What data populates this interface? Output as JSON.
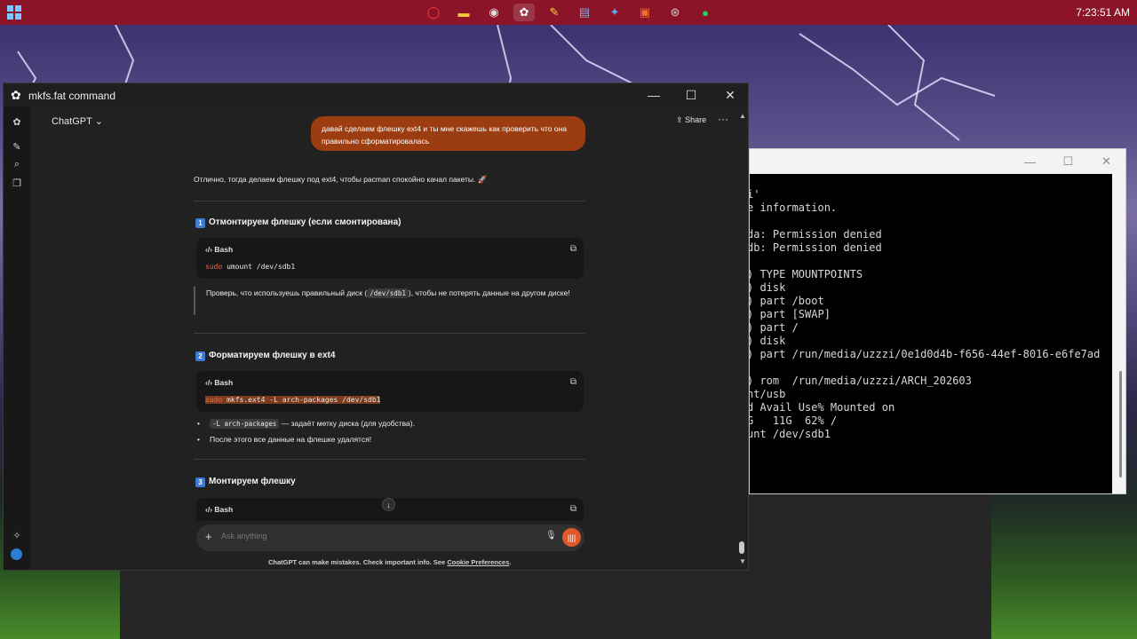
{
  "taskbar": {
    "clock": "7:23:51 AM",
    "icons": [
      "opera-icon",
      "file-explorer-icon",
      "obs-icon",
      "chatgpt-icon",
      "app-icon",
      "notes-icon",
      "vscode-icon",
      "office-icon",
      "steam-icon",
      "spotify-icon"
    ]
  },
  "terminal": {
    "lines": [
      "i'",
      "e information.",
      "",
      "da: Permission denied",
      "db: Permission denied",
      "",
      ") TYPE MOUNTPOINTS",
      ") disk",
      ") part /boot",
      ") part [SWAP]",
      ") part /",
      ") disk",
      ") part /run/media/uzzzi/0e1d0d4b-f656-44ef-8016-e6fe7ad",
      "",
      ") rom  /run/media/uzzzi/ARCH_202603",
      "nt/usb",
      "d Avail Use% Mounted on",
      "G   11G  62% /",
      "unt /dev/sdb1"
    ]
  },
  "chat": {
    "window_title": "mkfs.fat command",
    "model_label": "ChatGPT",
    "share_label": "Share",
    "user_message": "давай сделаем флешку ext4 и ты мне скажешь как проверить что она правильно сформатировалась",
    "intro": "Отлично, тогда делаем флешку под ext4, чтобы pacman спокойно качал пакеты. 🚀",
    "step1": {
      "num": "1",
      "heading": "Отмонтируем флешку (если смонтирована)",
      "lang": "Bash",
      "code_kw": "sudo",
      "code_rest": " umount /dev/sdb1",
      "note_before": "Проверь, что используешь правильный диск (",
      "note_code": "/dev/sdb1",
      "note_after": "), чтобы не потерять данные на другом диске!"
    },
    "step2": {
      "num": "2",
      "heading": "Форматируем флешку в ext4",
      "lang": "Bash",
      "code_kw": "sudo",
      "code_rest": " mkfs.ext4 -L arch-packages /dev/sdb1",
      "bullet1_code": "-L arch-packages",
      "bullet1_text": " — задаёт метку диска (для удобства).",
      "bullet2": "После этого все данные на флешке удалятся!"
    },
    "step3": {
      "num": "3",
      "heading": "Монтируем флешку",
      "lang": "Bash"
    },
    "composer_placeholder": "Ask anything",
    "footer_text": "ChatGPT can make mistakes. Check important info. See ",
    "footer_link": "Cookie Preferences",
    "footer_end": "."
  }
}
